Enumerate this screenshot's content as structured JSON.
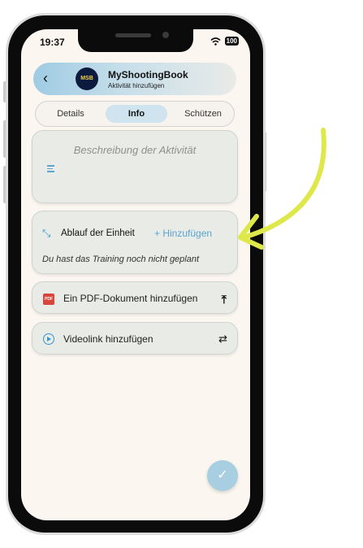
{
  "status_bar": {
    "time": "19:37",
    "battery": "100"
  },
  "app_bar": {
    "back_icon": "chevron-left-icon",
    "logo_text": "MSB",
    "title": "MyShootingBook",
    "subtitle": "Aktivität hinzufügen"
  },
  "tabs": [
    {
      "label": "Details",
      "active": false
    },
    {
      "label": "Info",
      "active": true
    },
    {
      "label": "Schützen",
      "active": false
    }
  ],
  "description": {
    "placeholder": "Beschreibung der Aktivität",
    "icon": "text-lines-icon"
  },
  "schedule": {
    "icon": "expand-arrows-icon",
    "label": "Ablauf der Einheit",
    "add_label": "+ Hinzufügen",
    "empty_text": "Du hast das Training noch nicht geplant"
  },
  "pdf": {
    "icon_text": "PDF",
    "label": "Ein PDF-Dokument hinzufügen",
    "action_icon": "upload-icon"
  },
  "video": {
    "icon": "play-circle-icon",
    "label": "Videolink hinzufügen",
    "action_icon": "link-icon"
  },
  "fab": {
    "icon": "check-icon"
  },
  "colors": {
    "accent": "#5aa4d3",
    "annotation_arrow": "#dfe84a"
  }
}
